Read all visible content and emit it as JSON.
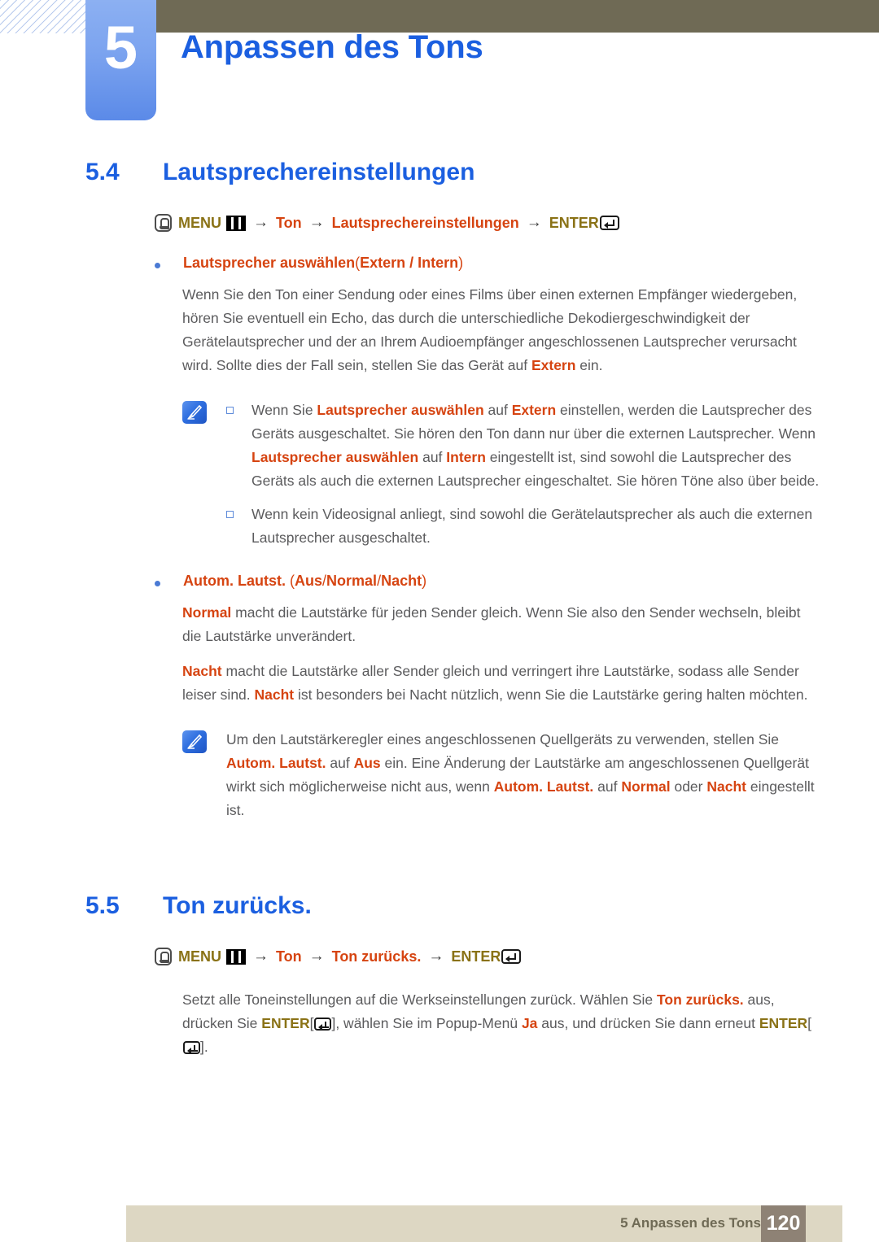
{
  "chapter": {
    "number": "5",
    "title": "Anpassen des Tons"
  },
  "sections": [
    {
      "number": "5.4",
      "title": "Lautsprechereinstellungen"
    },
    {
      "number": "5.5",
      "title": "Ton zurücks."
    }
  ],
  "menu_path_1": {
    "menu_label": "MENU",
    "arrow": "→",
    "item1": "Ton",
    "item2": "Lautsprechereinstellungen",
    "enter_label": "ENTER"
  },
  "menu_path_2": {
    "menu_label": "MENU",
    "arrow": "→",
    "item1": "Ton",
    "item2": "Ton zurücks.",
    "enter_label": "ENTER"
  },
  "bullet1": {
    "label": "Lautsprecher auswählen",
    "options_open": "(",
    "options": "Extern / Intern",
    "options_close": ")",
    "paragraph": {
      "part1": "Wenn Sie den Ton einer Sendung oder eines Films über einen externen Empfänger wiedergeben, hören Sie eventuell ein Echo, das durch die unterschiedliche Dekodiergeschwindigkeit der Gerätelautsprecher und der an Ihrem Audioempfänger angeschlossenen Lautsprecher verursacht wird. Sollte dies der Fall sein, stellen Sie das Gerät auf ",
      "hl1": "Extern",
      "part2": " ein."
    }
  },
  "note1": {
    "items": [
      {
        "p1": "Wenn Sie ",
        "h1": "Lautsprecher auswählen",
        "p2": " auf ",
        "h2": "Extern",
        "p3": " einstellen, werden die Lautsprecher des Geräts ausgeschaltet. Sie hören den Ton dann nur über die externen Lautsprecher. Wenn ",
        "h3": "Lautsprecher auswählen",
        "p4": " auf ",
        "h4": "Intern",
        "p5": " eingestellt ist, sind sowohl die Lautsprecher des Geräts als auch die externen Lautsprecher eingeschaltet. Sie hören Töne also über beide."
      },
      {
        "p1": "Wenn kein Videosignal anliegt, sind sowohl die Gerätelautsprecher als auch die externen Lautsprecher ausgeschaltet."
      }
    ]
  },
  "bullet2": {
    "label": "Autom. Lautst.",
    "options_open": "(",
    "opt1": "Aus",
    "sep1": "/",
    "opt2": "Normal",
    "sep2": "/",
    "opt3": "Nacht",
    "options_close": ")",
    "paragraph1": {
      "hl1": "Normal",
      "part1": " macht die Lautstärke für jeden Sender gleich. Wenn Sie also den Sender wechseln, bleibt die Lautstärke unverändert."
    },
    "paragraph2": {
      "hl1": "Nacht",
      "part1": " macht die Lautstärke aller Sender gleich und verringert ihre Lautstärke, sodass alle Sender leiser sind. ",
      "hl2": "Nacht",
      "part2": " ist besonders bei Nacht nützlich, wenn Sie die Lautstärke gering halten möchten."
    }
  },
  "note2": {
    "p1": "Um den Lautstärkeregler eines angeschlossenen Quellgeräts zu verwenden, stellen Sie ",
    "h1": "Autom. Lautst.",
    "p2": " auf ",
    "h2": "Aus",
    "p3": " ein. Eine Änderung der Lautstärke am angeschlossenen Quellgerät wirkt sich möglicherweise nicht aus, wenn ",
    "h3": "Autom. Lautst.",
    "p4": " auf ",
    "h4": "Normal",
    "p5": " oder ",
    "h5": "Nacht",
    "p6": " eingestellt ist."
  },
  "section55_body": {
    "p1": "Setzt alle Toneinstellungen auf die Werkseinstellungen zurück. Wählen Sie ",
    "h1": "Ton zurücks.",
    "p2": " aus, drücken Sie ",
    "enter1": "ENTER",
    "p3": "[",
    "p4": "], wählen Sie im Popup-Menü ",
    "h2": "Ja",
    "p5": " aus, und drücken Sie dann erneut ",
    "enter2": "ENTER",
    "p6": "[",
    "p7": "]."
  },
  "footer": {
    "label": "5 Anpassen des Tons",
    "page": "120"
  },
  "colors": {
    "heading_blue": "#1b5fe0",
    "accent_orange": "#d64411",
    "gold": "#8a7216",
    "olive": "#6f6a55",
    "footer_bar": "#ddd7c3",
    "footer_page": "#8e8275",
    "body_gray": "#5b5b5d"
  }
}
